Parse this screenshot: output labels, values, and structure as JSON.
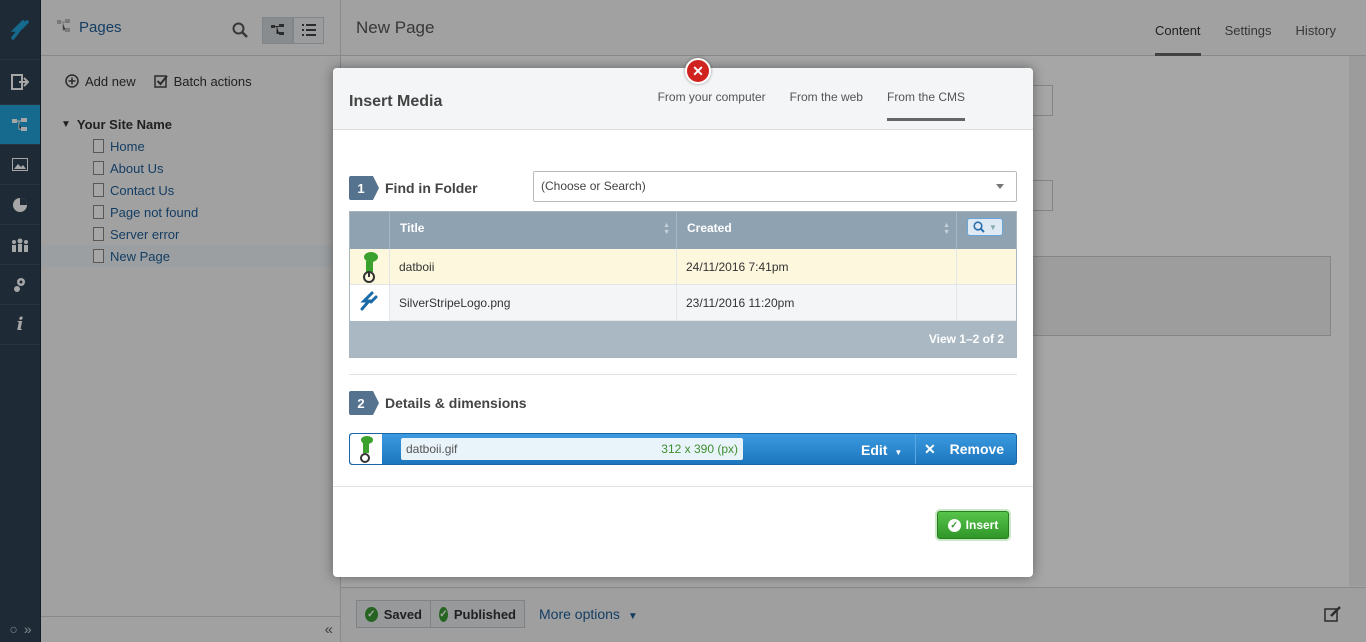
{
  "sidebar_rail": {
    "items": [
      "logo-icon",
      "logout-icon",
      "pages-icon",
      "files-icon",
      "reports-icon",
      "security-icon",
      "settings-icon",
      "help-icon"
    ]
  },
  "tree": {
    "title": "Pages",
    "add_new": "Add new",
    "batch_actions": "Batch actions",
    "root": "Your Site Name",
    "pages": [
      "Home",
      "About Us",
      "Contact Us",
      "Page not found",
      "Server error",
      "New Page"
    ]
  },
  "main": {
    "page_title": "New Page",
    "tabs": [
      "Content",
      "Settings",
      "History"
    ],
    "footer": {
      "saved": "Saved",
      "published": "Published",
      "more_options": "More options"
    }
  },
  "dialog": {
    "title": "Insert Media",
    "tabs": [
      "From your computer",
      "From the web",
      "From the CMS"
    ],
    "step1": {
      "num": "1",
      "title": "Find in Folder"
    },
    "folder_placeholder": "(Choose or Search)",
    "grid": {
      "columns": [
        "Title",
        "Created"
      ],
      "rows": [
        {
          "title": "datboii",
          "created": "24/11/2016 7:41pm"
        },
        {
          "title": "SilverStripeLogo.png",
          "created": "23/11/2016 11:20pm"
        }
      ],
      "footer": "View 1–2 of 2"
    },
    "step2": {
      "num": "2",
      "title": "Details & dimensions"
    },
    "file": {
      "name": "datboii.gif",
      "dimensions": "312 x 390 (px)",
      "edit": "Edit",
      "remove": "Remove"
    },
    "insert_label": "Insert"
  },
  "colors": {
    "accent": "#23a4db",
    "rail": "#2f4254",
    "insert": "#3aa832",
    "remove_bar": "#2a87cf"
  }
}
